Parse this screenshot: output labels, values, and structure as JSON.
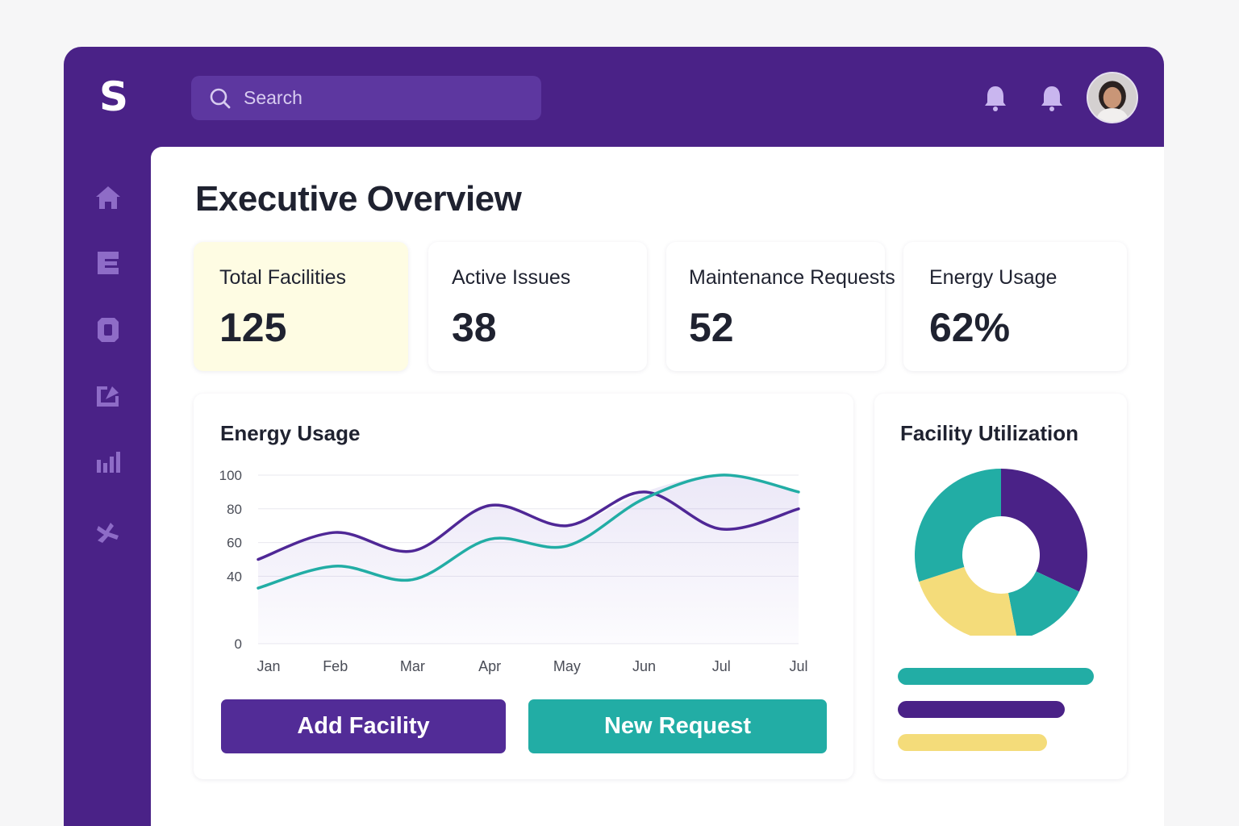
{
  "app": {
    "logo_letter": "S"
  },
  "search": {
    "placeholder": "Search",
    "icon": "search-icon"
  },
  "header": {
    "icons": [
      "bell-icon",
      "bell-icon"
    ],
    "avatar": "user-avatar"
  },
  "sidebar": {
    "items": [
      {
        "icon": "home-icon"
      },
      {
        "icon": "building-icon"
      },
      {
        "icon": "device-icon"
      },
      {
        "icon": "reports-icon"
      },
      {
        "icon": "analytics-icon"
      },
      {
        "icon": "tools-icon"
      }
    ]
  },
  "page": {
    "title": "Executive Overview"
  },
  "stats": [
    {
      "label": "Total Facilities",
      "value": "125"
    },
    {
      "label": "Active Issues",
      "value": "38"
    },
    {
      "label": "Maintenance Requests",
      "value": "52"
    },
    {
      "label": "Energy Usage",
      "value": "62%"
    }
  ],
  "energy_card": {
    "title": "Energy Usage"
  },
  "utilization_card": {
    "title": "Facility Utilization"
  },
  "actions": {
    "add_facility": "Add Facility",
    "new_request": "New Request"
  },
  "colors": {
    "primary": "#4a2287",
    "purple_series": "#4f2796",
    "teal": "#22ada5",
    "yellow": "#f4dc7a",
    "highlight_card": "#fefce3"
  },
  "chart_data": [
    {
      "type": "line",
      "title": "Energy Usage",
      "x": [
        "Jan",
        "Feb",
        "Mar",
        "Apr",
        "May",
        "Jun",
        "Jul",
        "Jul"
      ],
      "yticks": [
        0,
        40,
        60,
        80,
        100
      ],
      "ylim": [
        0,
        100
      ],
      "grid": true,
      "series": [
        {
          "color": "#4f2796",
          "values": [
            50,
            66,
            55,
            82,
            70,
            90,
            68,
            80
          ]
        },
        {
          "color": "#22ada5",
          "values": [
            33,
            46,
            38,
            62,
            58,
            86,
            100,
            90
          ]
        }
      ]
    },
    {
      "type": "pie",
      "donut": true,
      "title": "Facility Utilization",
      "slices": [
        {
          "color": "#4a2287",
          "value": 32
        },
        {
          "color": "#22ada5",
          "value": 15
        },
        {
          "color": "#f4dc7a",
          "value": 23
        },
        {
          "color": "#22ada5",
          "value": 30
        }
      ],
      "bars": [
        {
          "color": "#22ada5",
          "value": 1.0
        },
        {
          "color": "#4a2287",
          "value": 0.85
        },
        {
          "color": "#f4dc7a",
          "value": 0.76
        }
      ]
    }
  ]
}
